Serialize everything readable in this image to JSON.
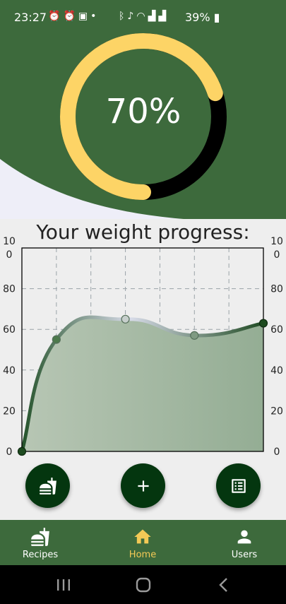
{
  "status_bar": {
    "time": "23:27",
    "left_icons": [
      "alarm-icon",
      "alarm-icon",
      "image-icon",
      "dot-icon"
    ],
    "right_icons": [
      "bluetooth-icon",
      "mute-icon",
      "wifi-icon",
      "signal-icon",
      "signal-icon"
    ],
    "battery": "39%"
  },
  "progress": {
    "label": "70%",
    "fraction": 0.7,
    "track_color": "#000000",
    "fill_color": "#fdd466"
  },
  "theme": {
    "primary": "#3d6a3c",
    "dark": "#04360f",
    "accent": "#f3c956"
  },
  "chart_title": "Your weight progress:",
  "chart_data": {
    "type": "area",
    "x": [
      0,
      1,
      2,
      3,
      4,
      5,
      6,
      7
    ],
    "values": [
      {
        "x": 0,
        "y": 0
      },
      {
        "x": 1,
        "y": 55
      },
      {
        "x": 3,
        "y": 65
      },
      {
        "x": 5,
        "y": 57
      },
      {
        "x": 7,
        "y": 63
      }
    ],
    "ylim": [
      0,
      100
    ],
    "xlim": [
      0,
      7
    ],
    "y_ticks_left": [
      "0",
      "20",
      "40",
      "60",
      "80",
      "10\n0"
    ],
    "y_ticks_right": [
      "0",
      "20",
      "40",
      "60",
      "80",
      "10\n0"
    ],
    "y_tick_values": [
      0,
      20,
      40,
      60,
      80,
      100
    ],
    "grid": true,
    "title": "Your weight progress:"
  },
  "fabs": [
    {
      "name": "recipes-fab",
      "icon": "fastfood-icon"
    },
    {
      "name": "add-fab",
      "icon": "plus-icon"
    },
    {
      "name": "list-fab",
      "icon": "list-alt-icon"
    }
  ],
  "bottom_nav": {
    "items": [
      {
        "label": "Recipes",
        "icon": "fastfood-icon",
        "active": false
      },
      {
        "label": "Home",
        "icon": "home-icon",
        "active": true
      },
      {
        "label": "Users",
        "icon": "person-icon",
        "active": false
      }
    ]
  },
  "system_nav": [
    "recents-button",
    "home-button",
    "back-button"
  ]
}
